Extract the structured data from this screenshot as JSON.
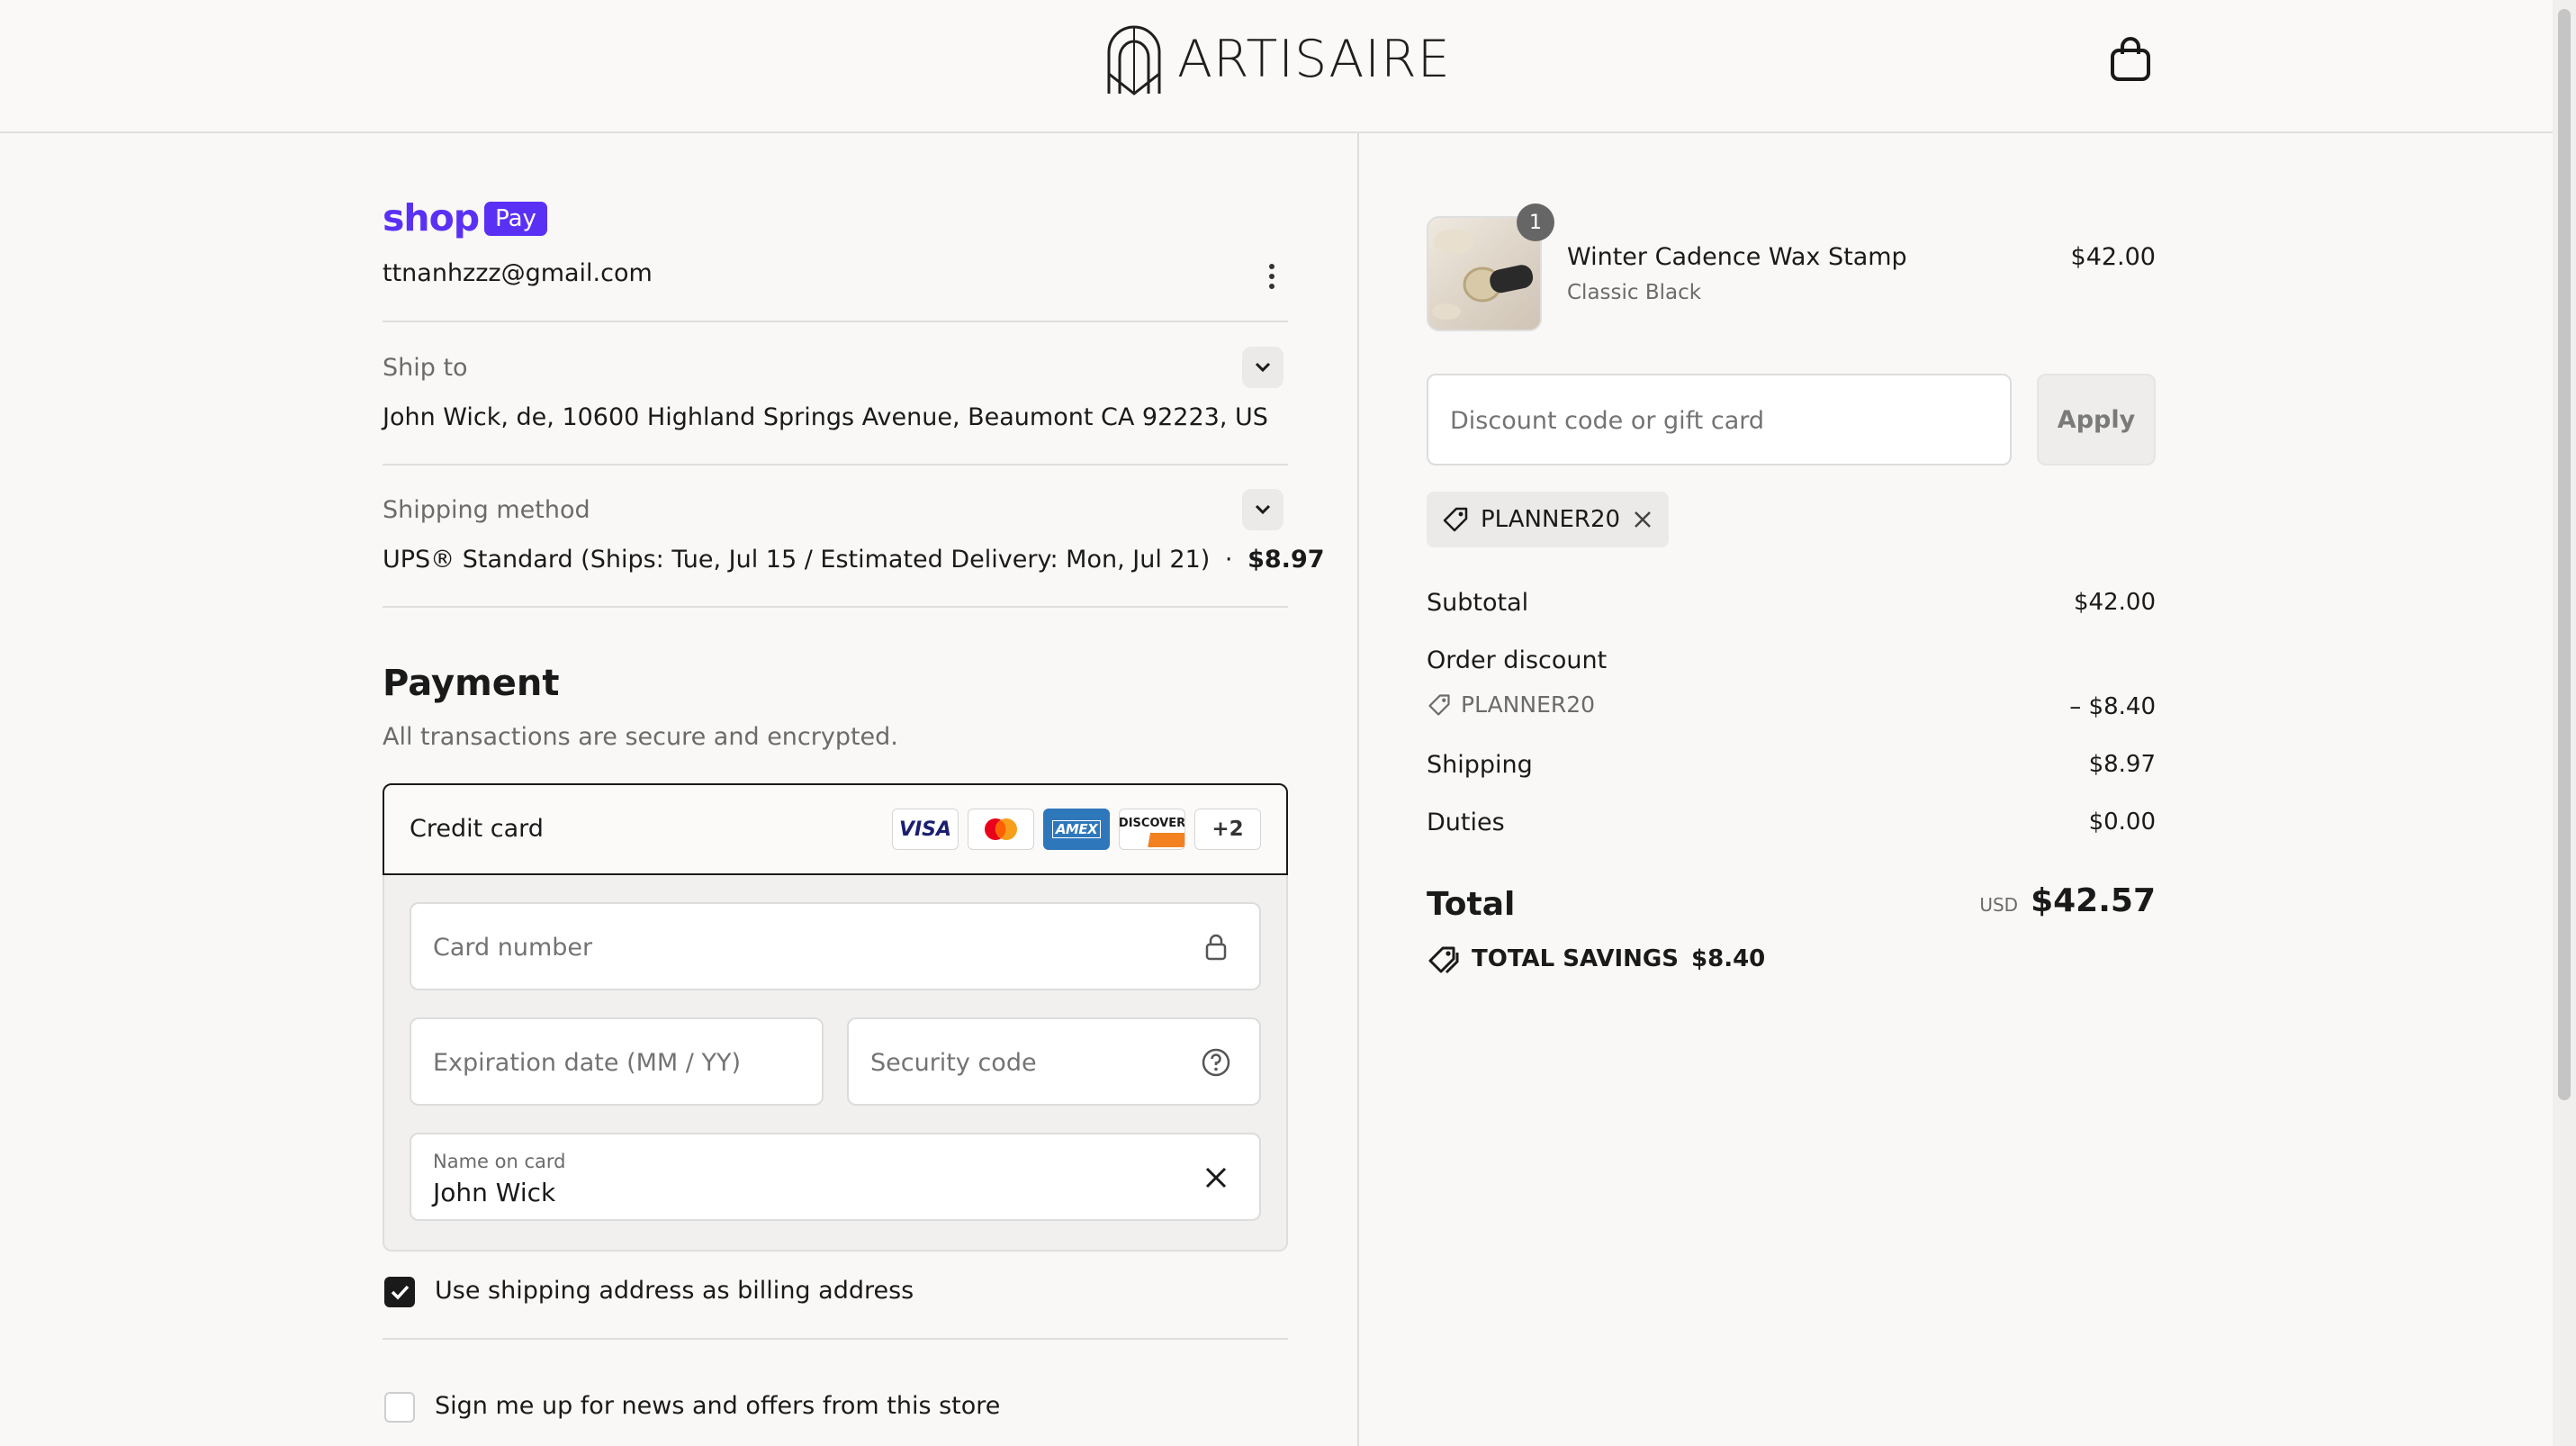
{
  "header": {
    "brand": "ARTISAIRE"
  },
  "express": {
    "shop_word": "shop",
    "pay_word": "Pay",
    "email": "ttnanhzzz@gmail.com"
  },
  "ship_to": {
    "label": "Ship to",
    "value": "John Wick, de, 10600 Highland Springs Avenue, Beaumont CA 92223, US"
  },
  "shipping_method": {
    "label": "Shipping method",
    "value": "UPS® Standard (Ships: Tue, Jul 15 / Estimated Delivery: Mon, Jul 21)",
    "dot": "·",
    "price": "$8.97"
  },
  "payment": {
    "title": "Payment",
    "subtitle": "All transactions are secure and encrypted.",
    "method_label": "Credit card",
    "card_brands": [
      "VISA",
      "mastercard",
      "AMEX",
      "DISCOVER",
      "+2"
    ],
    "card_number_placeholder": "Card number",
    "expiration_placeholder": "Expiration date (MM / YY)",
    "security_placeholder": "Security code",
    "name_label": "Name on card",
    "name_value": "John Wick",
    "billing_checkbox": {
      "label": "Use shipping address as billing address",
      "checked": true
    },
    "news_checkbox": {
      "label": "Sign me up for news and offers from this store",
      "checked": false
    }
  },
  "order": {
    "item": {
      "quantity": "1",
      "name": "Winter Cadence Wax Stamp",
      "variant": "Classic Black",
      "price": "$42.00"
    },
    "discount_placeholder": "Discount code or gift card",
    "apply_label": "Apply",
    "applied_code": "PLANNER20",
    "subtotal_label": "Subtotal",
    "subtotal_value": "$42.00",
    "order_discount_label": "Order discount",
    "discount_code": "PLANNER20",
    "discount_value": "– $8.40",
    "shipping_label": "Shipping",
    "shipping_value": "$8.97",
    "duties_label": "Duties",
    "duties_value": "$0.00",
    "total_label": "Total",
    "currency": "USD",
    "total_value": "$42.57",
    "savings_label": "TOTAL SAVINGS",
    "savings_value": "$8.40"
  },
  "colors": {
    "shop_pay": "#5a31f4",
    "text": "#1a1a1a",
    "muted": "#6b6b6b",
    "border": "#dedede"
  }
}
